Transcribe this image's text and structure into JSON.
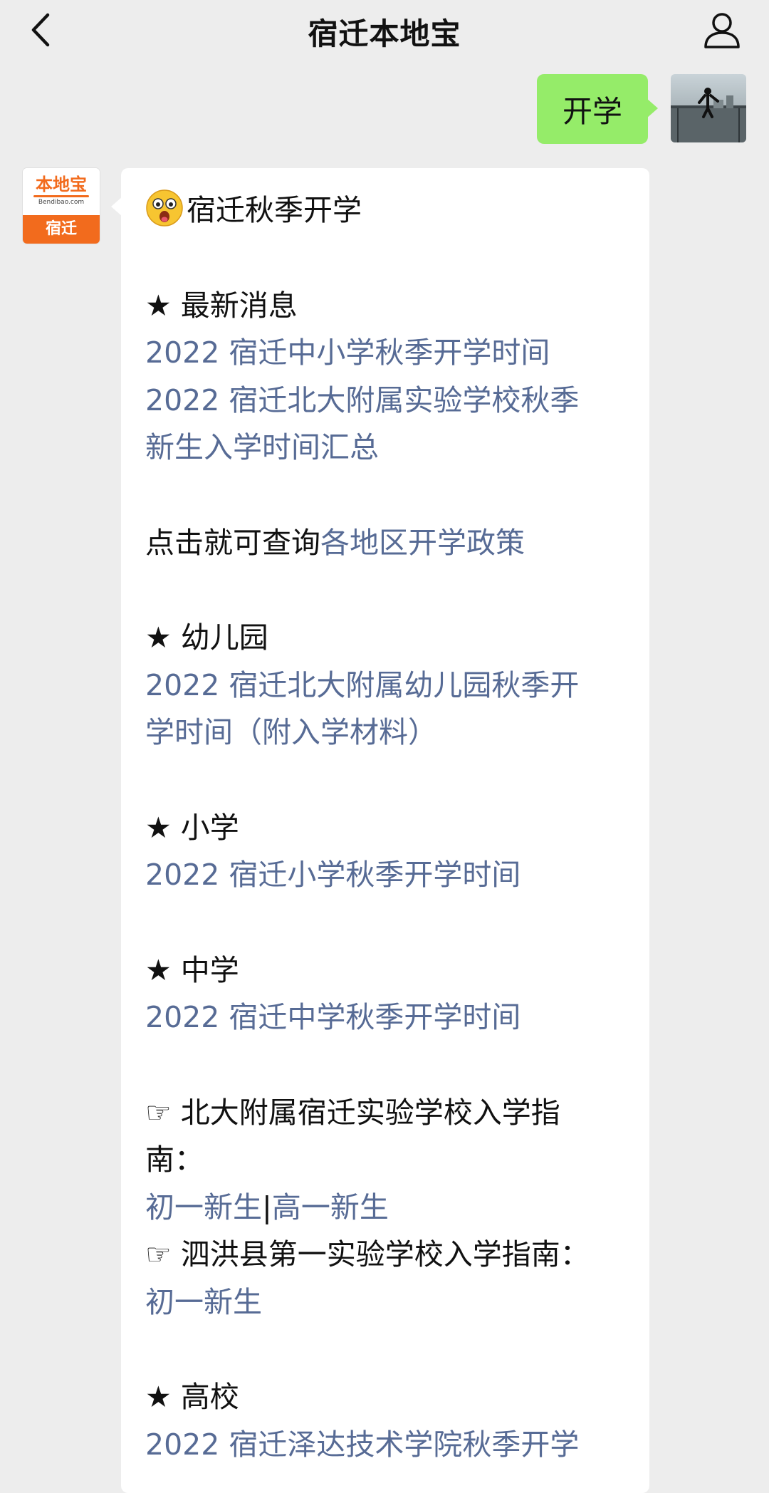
{
  "header": {
    "title": "宿迁本地宝"
  },
  "messages": {
    "outgoing": {
      "text": "开学"
    },
    "incoming": {
      "avatar_logo_text": "本地宝",
      "avatar_url_text": "Bendibao.com",
      "avatar_city": "宿迁",
      "heading": "宿迁秋季开学",
      "latest_header": "★ 最新消息",
      "latest_link_1": "2022 宿迁中小学秋季开学时间",
      "latest_link_2_line1": "2022 宿迁北大附属实验学校秋季",
      "latest_link_2_line2": "新生入学时间汇总",
      "query_prefix": "点击就可查询",
      "query_link": "各地区开学政策",
      "kindergarten_header": "★ 幼儿园",
      "kindergarten_link_line1": "2022 宿迁北大附属幼儿园秋季开",
      "kindergarten_link_line2": "学时间（附入学材料）",
      "primary_header": "★ 小学",
      "primary_link": "2022 宿迁小学秋季开学时间",
      "middle_header": "★ 中学",
      "middle_link": "2022 宿迁中学秋季开学时间",
      "guide1_line1": "☞ 北大附属宿迁实验学校入学指",
      "guide1_line2": "南：",
      "guide1_link_a": "初一新生",
      "guide1_separator": "|",
      "guide1_link_b": "高一新生",
      "guide2_line1": "☞ 泗洪县第一实验学校入学指南：",
      "guide2_link": "初一新生",
      "college_header": "★ 高校",
      "college_link": "2022 宿迁泽达技术学院秋季开学"
    }
  },
  "colors": {
    "background": "#ededed",
    "outgoing_bubble": "#95ec69",
    "link": "#576b95",
    "brand_orange": "#f26b1d"
  },
  "icons": [
    "back-chevron-icon",
    "profile-icon",
    "surprised-face-emoji"
  ]
}
